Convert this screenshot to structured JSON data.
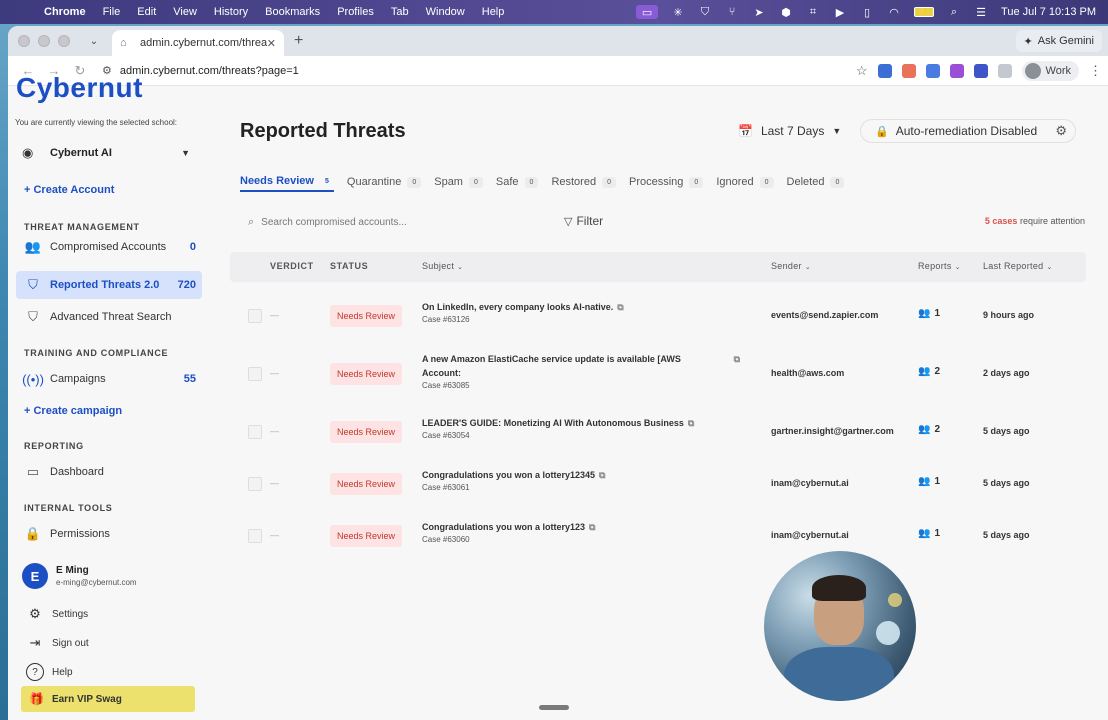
{
  "menubar": {
    "app": "Chrome",
    "items": [
      "File",
      "Edit",
      "View",
      "History",
      "Bookmarks",
      "Profiles",
      "Tab",
      "Window",
      "Help"
    ],
    "datetime": "Tue Jul 7  10:13 PM"
  },
  "browser": {
    "tab_title": "admin.cybernut.com/threats",
    "url": "admin.cybernut.com/threats?page=1",
    "ask_gemini": "Ask Gemini",
    "profile": "Work"
  },
  "sidebar": {
    "logo": "Cybernut",
    "viewing_text": "You are currently viewing the selected school:",
    "school": "Cybernut AI",
    "create_account": "+ Create Account",
    "sections": {
      "threat_management": "THREAT MANAGEMENT",
      "training": "TRAINING AND COMPLIANCE",
      "reporting": "REPORTING",
      "internal": "INTERNAL TOOLS"
    },
    "items": {
      "compromised": {
        "label": "Compromised Accounts",
        "count": "0"
      },
      "reported": {
        "label": "Reported Threats 2.0",
        "count": "720"
      },
      "advanced": {
        "label": "Advanced Threat Search"
      },
      "campaigns": {
        "label": "Campaigns",
        "count": "55"
      },
      "create_campaign": "+ Create campaign",
      "dashboard": {
        "label": "Dashboard"
      },
      "permissions": {
        "label": "Permissions"
      }
    },
    "user": {
      "initial": "E",
      "name": "E Ming",
      "email": "e-ming@cybernut.com"
    },
    "footer": {
      "settings": "Settings",
      "signout": "Sign out",
      "help": "Help",
      "vip": "Earn VIP Swag"
    }
  },
  "main": {
    "title": "Reported Threats",
    "date_range": "Last 7 Days",
    "auto_remediation": "Auto-remediation Disabled",
    "tabs": [
      {
        "label": "Needs Review",
        "count": "5"
      },
      {
        "label": "Quarantine",
        "count": "0"
      },
      {
        "label": "Spam",
        "count": "0"
      },
      {
        "label": "Safe",
        "count": "0"
      },
      {
        "label": "Restored",
        "count": "0"
      },
      {
        "label": "Processing",
        "count": "0"
      },
      {
        "label": "Ignored",
        "count": "0"
      },
      {
        "label": "Deleted",
        "count": "0"
      }
    ],
    "search_placeholder": "Search compromised accounts...",
    "filter": "Filter",
    "attention_count": "5 cases",
    "attention_text": "require attention",
    "columns": {
      "verdict": "VERDICT",
      "status": "STATUS",
      "subject": "Subject",
      "sender": "Sender",
      "reports": "Reports",
      "last_reported": "Last Reported"
    },
    "rows": [
      {
        "status": "Needs Review",
        "subject": "On LinkedIn, every company looks AI-native.",
        "case": "Case #63126",
        "sender": "events@send.zapier.com",
        "reports": "1",
        "last": "9 hours ago"
      },
      {
        "status": "Needs Review",
        "subject": "A new Amazon ElastiCache service update is available [AWS Account:",
        "case": "Case #63085",
        "sender": "health@aws.com",
        "reports": "2",
        "last": "2 days ago"
      },
      {
        "status": "Needs Review",
        "subject": "LEADER'S GUIDE: Monetizing AI With Autonomous Business",
        "case": "Case #63054",
        "sender": "gartner.insight@gartner.com",
        "reports": "2",
        "last": "5 days ago"
      },
      {
        "status": "Needs Review",
        "subject": "Congradulations you won a lottery12345",
        "case": "Case #63061",
        "sender": "inam@cybernut.ai",
        "reports": "1",
        "last": "5 days ago"
      },
      {
        "status": "Needs Review",
        "subject": "Congradulations you won a lottery123",
        "case": "Case #63060",
        "sender": "inam@cybernut.ai",
        "reports": "1",
        "last": "5 days ago"
      }
    ]
  }
}
